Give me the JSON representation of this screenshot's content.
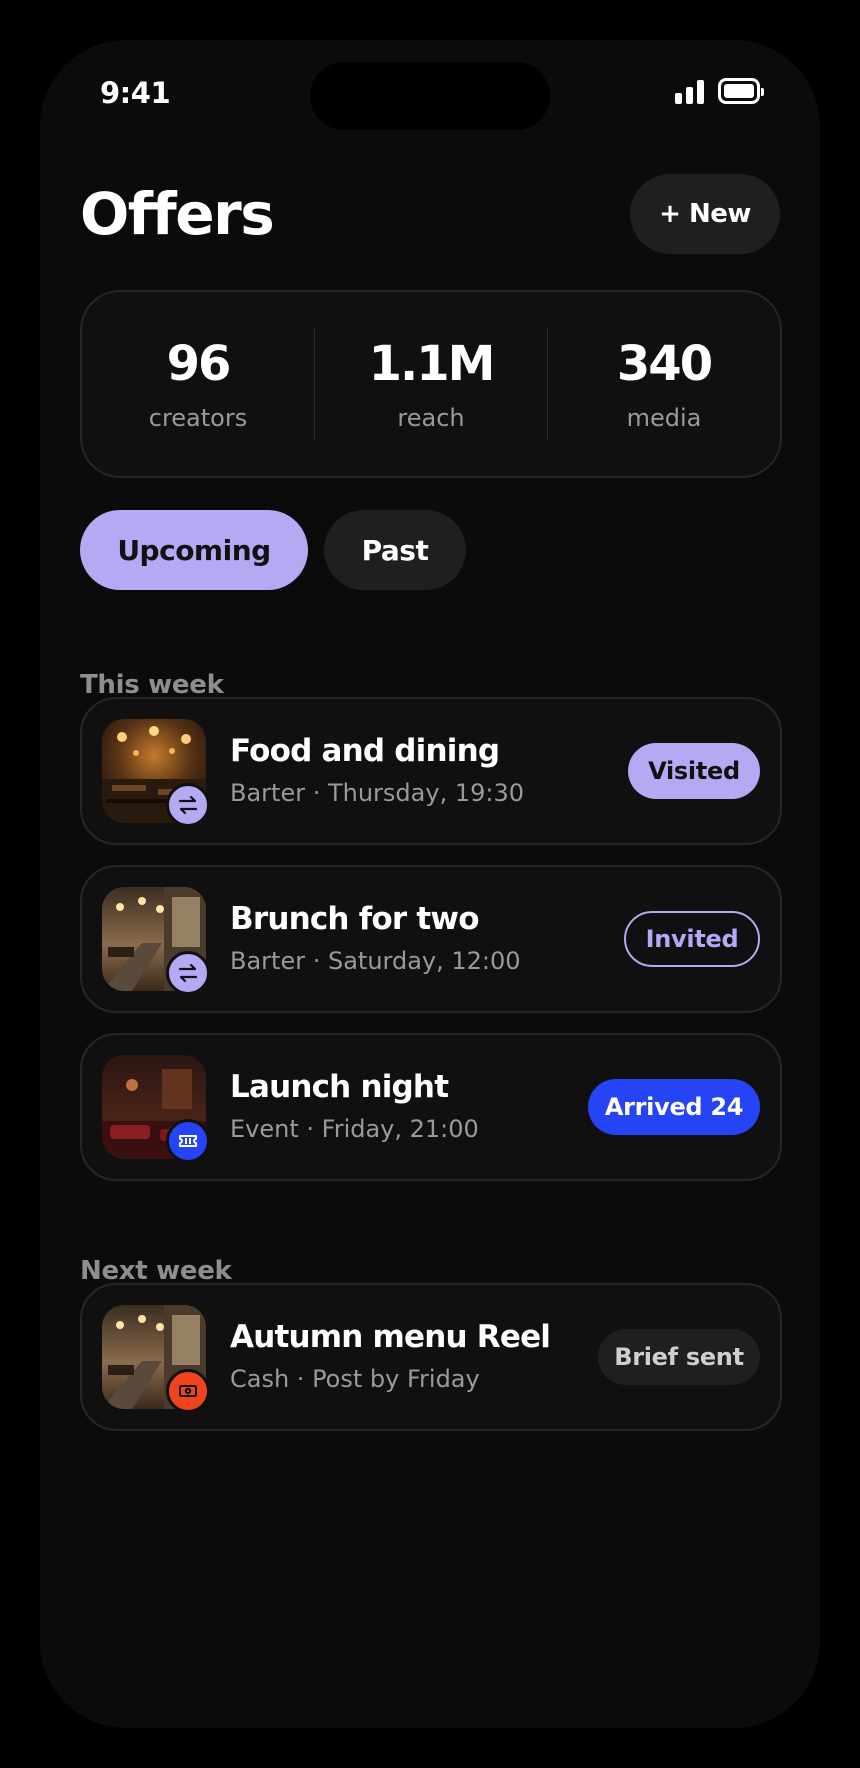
{
  "status_bar": {
    "time": "9:41"
  },
  "header": {
    "title": "Offers",
    "new_button_label": "+ New"
  },
  "stats": [
    {
      "value": "96",
      "label": "creators"
    },
    {
      "value": "1.1M",
      "label": "reach"
    },
    {
      "value": "340",
      "label": "media"
    }
  ],
  "tabs": [
    {
      "label": "Upcoming",
      "selected": true
    },
    {
      "label": "Past",
      "selected": false
    }
  ],
  "sections": [
    {
      "heading": "This week",
      "items": [
        {
          "title": "Food and dining",
          "subtitle": "Barter · Thursday, 19:30",
          "status": "Visited",
          "badge_icon": "swap-icon",
          "badge_color": "#b4a9f3"
        },
        {
          "title": "Brunch for two",
          "subtitle": "Barter · Saturday, 12:00",
          "status": "Invited",
          "badge_icon": "swap-icon",
          "badge_color": "#b4a9f3"
        },
        {
          "title": "Launch night",
          "subtitle": "Event · Friday, 21:00",
          "status": "Arrived 24",
          "badge_icon": "ticket-icon",
          "badge_color": "#2444f5"
        }
      ]
    },
    {
      "heading": "Next week",
      "items": [
        {
          "title": "Autumn menu Reel",
          "subtitle": "Cash · Post by Friday",
          "status": "Brief sent",
          "badge_icon": "cash-icon",
          "badge_color": "#f0441c"
        }
      ]
    }
  ],
  "colors": {
    "accent": "#b4a9f3",
    "blue": "#2444f5",
    "orange": "#f0441c",
    "background": "#0b0b0b"
  }
}
